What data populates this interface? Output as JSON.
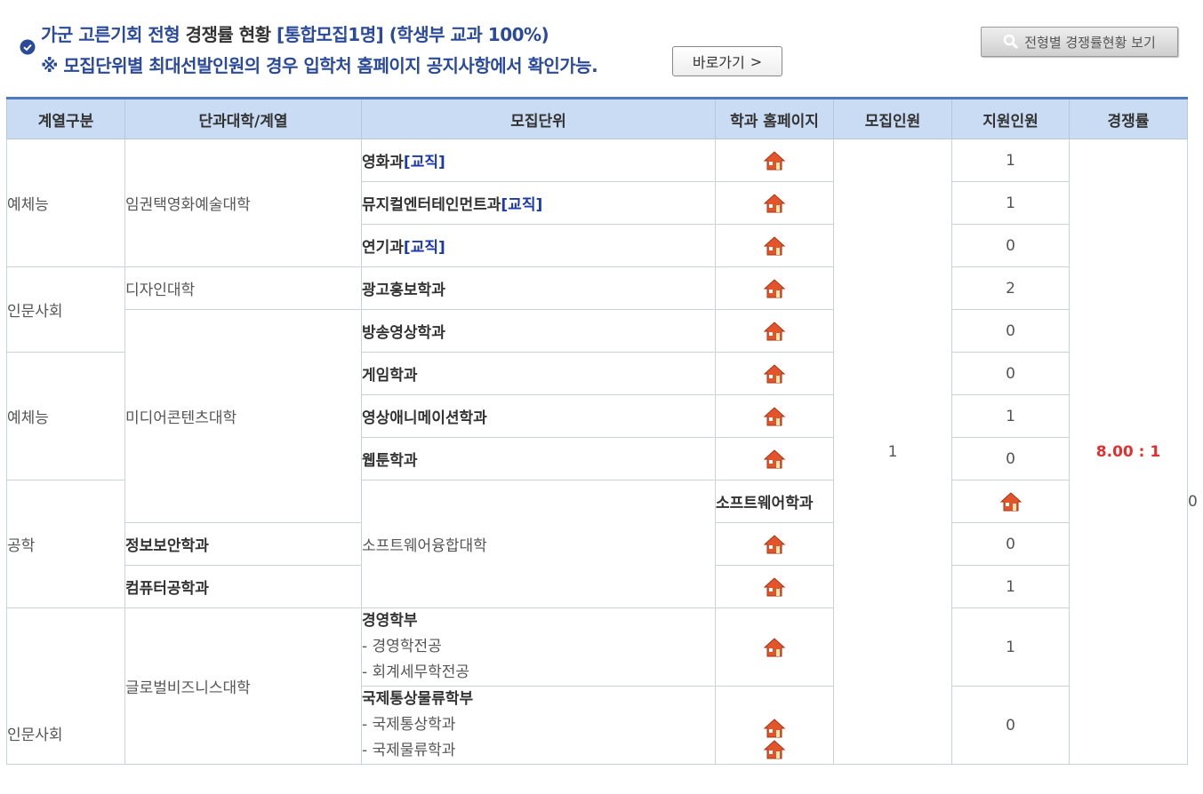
{
  "header": {
    "title_part1": "가군 고른기회 전형",
    "title_part2": "경쟁률 현황",
    "title_part3": "[통합모집1명] (학생부 교과 100%)",
    "notice": "※ 모집단위별 최대선발인원의 경우 입학처 홈페이지 공지사항에서 확인가능.",
    "goto_label": "바로가기",
    "goto_arrow": ">",
    "view_label": "전형별 경쟁률현황 보기",
    "check_icon": "check-circle-icon",
    "search_icon": "search-icon"
  },
  "table": {
    "headers": [
      "계열구분",
      "단과대학/계열",
      "모집단위",
      "학과 홈페이지",
      "모집인원",
      "지원인원",
      "경쟁률"
    ],
    "home_icon": "home-icon",
    "categories": [
      "예체능",
      "인문사회",
      "예체능",
      "공학",
      "인문사회"
    ],
    "colleges": [
      "임권택영화예술대학",
      "디자인대학",
      "미디어콘텐츠대학",
      "소프트웨어융합대학",
      "글로벌비즈니스대학"
    ],
    "units": [
      {
        "name": "영화과",
        "tag": "[교직]",
        "applicants": "1"
      },
      {
        "name": "뮤지컬엔터테인먼트과",
        "tag": "[교직]",
        "applicants": "1"
      },
      {
        "name": "연기과",
        "tag": "[교직]",
        "applicants": "0"
      },
      {
        "name": "광고홍보학과",
        "applicants": "2"
      },
      {
        "name": "방송영상학과",
        "applicants": "0"
      },
      {
        "name": "게임학과",
        "applicants": "0"
      },
      {
        "name": "영상애니메이션학과",
        "applicants": "1"
      },
      {
        "name": "웹툰학과",
        "applicants": "0"
      },
      {
        "name": "소프트웨어학과",
        "applicants": "0"
      },
      {
        "name": "정보보안학과",
        "applicants": "0"
      },
      {
        "name": "컴퓨터공학과",
        "applicants": "1"
      },
      {
        "name": "경영학부",
        "sub1": "- 경영학전공",
        "sub2": "- 회계세무학전공",
        "applicants": "1"
      },
      {
        "name": "국제통상물류학부",
        "sub1": "- 국제통상학과",
        "sub2": "- 국제물류학과",
        "applicants": "0"
      }
    ],
    "recruit_count": "1",
    "ratio": "8.00 : 1"
  },
  "colors": {
    "title_blue": "#2b4a9a",
    "header_bg": "#c9dcf3",
    "ratio_red": "#e03030",
    "home_red": "#e2552b"
  }
}
